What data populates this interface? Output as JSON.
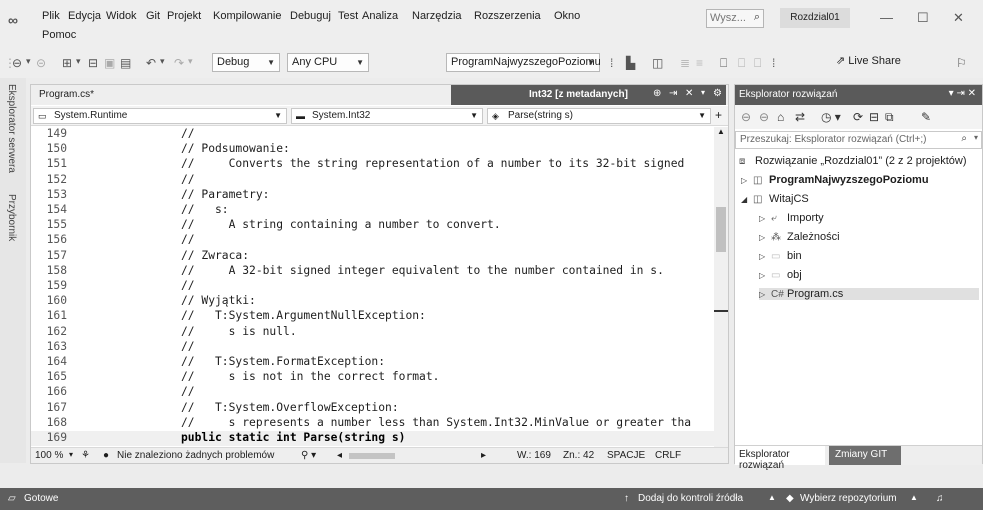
{
  "menu": {
    "items": [
      "Plik",
      "Edycja",
      "Widok",
      "Git",
      "Projekt",
      "Kompilowanie",
      "Debuguj",
      "Test",
      "Analiza",
      "Narzędzia",
      "Rozszerzenia",
      "Okno"
    ],
    "help": "Pomoc",
    "search_placeholder": "Wysz...",
    "solution_name": "Rozdzial01"
  },
  "toolbar": {
    "config": "Debug",
    "platform": "Any CPU",
    "startup_project": "ProgramNajwyzszegoPoziomu",
    "live_share": "Live Share"
  },
  "left_tabs": [
    "Eksplorator serwera",
    "Przybornik"
  ],
  "editor": {
    "tab_program": "Program.cs*",
    "tab_int32": "Int32 [z metadanych]",
    "nav_namespace": "System.Runtime",
    "nav_type": "System.Int32",
    "nav_member": "Parse(string s)",
    "lines": [
      {
        "n": "149",
        "t": "//"
      },
      {
        "n": "150",
        "t": "// Podsumowanie:"
      },
      {
        "n": "151",
        "t": "//     Converts the string representation of a number to its 32-bit signed"
      },
      {
        "n": "152",
        "t": "//"
      },
      {
        "n": "153",
        "t": "// Parametry:"
      },
      {
        "n": "154",
        "t": "//   s:"
      },
      {
        "n": "155",
        "t": "//     A string containing a number to convert."
      },
      {
        "n": "156",
        "t": "//"
      },
      {
        "n": "157",
        "t": "// Zwraca:"
      },
      {
        "n": "158",
        "t": "//     A 32-bit signed integer equivalent to the number contained in s."
      },
      {
        "n": "159",
        "t": "//"
      },
      {
        "n": "160",
        "t": "// Wyjątki:"
      },
      {
        "n": "161",
        "t": "//   T:System.ArgumentNullException:"
      },
      {
        "n": "162",
        "t": "//     s is null."
      },
      {
        "n": "163",
        "t": "//"
      },
      {
        "n": "164",
        "t": "//   T:System.FormatException:"
      },
      {
        "n": "165",
        "t": "//     s is not in the correct format."
      },
      {
        "n": "166",
        "t": "//"
      },
      {
        "n": "167",
        "t": "//   T:System.OverflowException:"
      },
      {
        "n": "168",
        "t": "//     s represents a number less than System.Int32.MinValue or greater tha"
      },
      {
        "n": "169",
        "t": "public static int Parse(string s)"
      }
    ],
    "status": {
      "zoom": "100 %",
      "problems": "Nie znaleziono żadnych problemów",
      "line": "W.: 169",
      "col": "Zn.: 42",
      "spaces": "SPACJE",
      "eol": "CRLF"
    }
  },
  "explorer": {
    "title": "Eksplorator rozwiązań",
    "search_placeholder": "Przeszukaj: Eksplorator rozwiązań (Ctrl+;)",
    "solution": "Rozwiązanie „Rozdzial01” (2 z 2 projektów)",
    "project1": "ProgramNajwyzszegoPoziomu",
    "project2": "WitajCS",
    "items": [
      "Importy",
      "Zależności",
      "bin",
      "obj",
      "Program.cs"
    ],
    "tab_active": "Eksplorator rozwiązań",
    "tab_git": "Zmiany GIT"
  },
  "statusbar": {
    "ready": "Gotowe",
    "source_control": "Dodaj do kontroli źródła",
    "repository": "Wybierz repozytorium"
  }
}
